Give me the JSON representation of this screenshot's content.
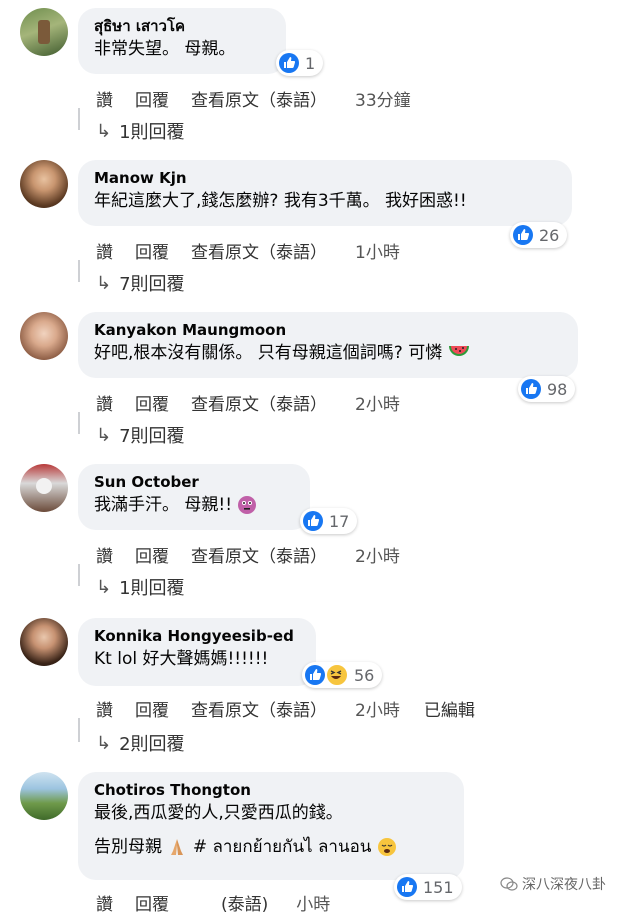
{
  "comments": [
    {
      "author": "สุธิษา เสาวโค",
      "lines": [
        "非常失望。 母親。"
      ],
      "reaction_count": "1",
      "actions": {
        "like": "讚",
        "reply": "回覆",
        "translate": "查看原文（泰語）",
        "time": "33分鐘"
      },
      "replies": "1則回覆"
    },
    {
      "author": "Manow Kjn",
      "lines": [
        "年紀這麼大了,錢怎麼辦? 我有3千萬。 我好困惑!!"
      ],
      "reaction_count": "26",
      "actions": {
        "like": "讚",
        "reply": "回覆",
        "translate": "查看原文（泰語）",
        "time": "1小時"
      },
      "replies": "7則回覆"
    },
    {
      "author": "Kanyakon Maungmoon",
      "lines": [
        "好吧,根本沒有關係。 只有母親這個詞嗎? 可憐"
      ],
      "reaction_count": "98",
      "actions": {
        "like": "讚",
        "reply": "回覆",
        "translate": "查看原文（泰語）",
        "time": "2小時"
      },
      "replies": "7則回覆"
    },
    {
      "author": "Sun October",
      "lines": [
        "我滿手汗。 母親!!"
      ],
      "reaction_count": "17",
      "actions": {
        "like": "讚",
        "reply": "回覆",
        "translate": "查看原文（泰語）",
        "time": "2小時"
      },
      "replies": "1則回覆"
    },
    {
      "author": "Konnika Hongyeesib-ed",
      "lines": [
        "Kt lol 好大聲媽媽!!!!!!"
      ],
      "reaction_count": "56",
      "actions": {
        "like": "讚",
        "reply": "回覆",
        "translate": "查看原文（泰語）",
        "time": "2小時",
        "edited": "已編輯"
      },
      "replies": "2則回覆"
    },
    {
      "author": "Chotiros Thongton",
      "lines": [
        "最後,西瓜愛的人,只愛西瓜的錢。",
        "告別母親",
        "# ลายกย้ายกันไ ลานอน"
      ],
      "reaction_count": "151",
      "actions": {
        "like": "讚",
        "reply": "回覆",
        "translate": "(泰語)",
        "time": "小時"
      }
    }
  ],
  "watermark": "深八深夜八卦",
  "colors": {
    "like_blue": "#1877f2",
    "bubble_bg": "#f0f2f5"
  },
  "icons": [
    "like-icon",
    "haha-icon",
    "watermelon-icon",
    "flushed-face-icon",
    "pray-hands-icon",
    "sleepy-face-icon",
    "reply-arrow-icon"
  ]
}
